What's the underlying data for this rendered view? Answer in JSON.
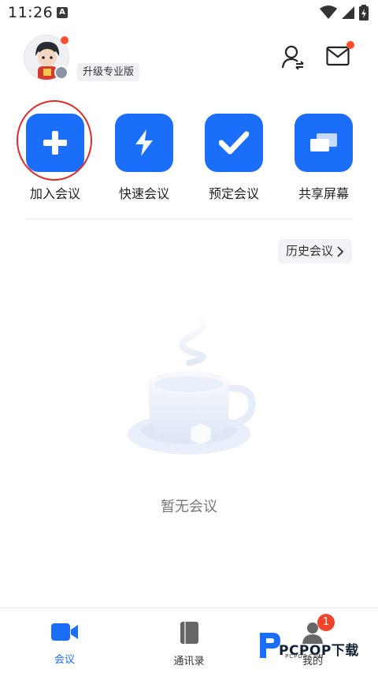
{
  "status_bar": {
    "time": "11:26",
    "notification_icon_letter": "A"
  },
  "header": {
    "upgrade_label": "升级专业版"
  },
  "actions": [
    {
      "label": "加入会议",
      "icon": "plus-icon"
    },
    {
      "label": "快速会议",
      "icon": "lightning-icon"
    },
    {
      "label": "预定会议",
      "icon": "checkmark-icon"
    },
    {
      "label": "共享屏幕",
      "icon": "share-screen-icon"
    }
  ],
  "history_button": {
    "label": "历史会议"
  },
  "empty_state": {
    "text": "暂无会议"
  },
  "bottom_nav": {
    "items": [
      {
        "label": "会议",
        "icon": "video-camera-icon",
        "active": true
      },
      {
        "label": "通讯录",
        "icon": "address-book-icon",
        "active": false
      },
      {
        "label": "我的",
        "icon": "user-icon",
        "active": false
      }
    ],
    "badge_count": "1"
  },
  "watermark": {
    "text": "PCPOP下载",
    "sub": "PCPOP.COM"
  },
  "colors": {
    "accent": "#1a6efa",
    "badge": "#f0432c",
    "highlight_ring": "#e02a2a"
  }
}
